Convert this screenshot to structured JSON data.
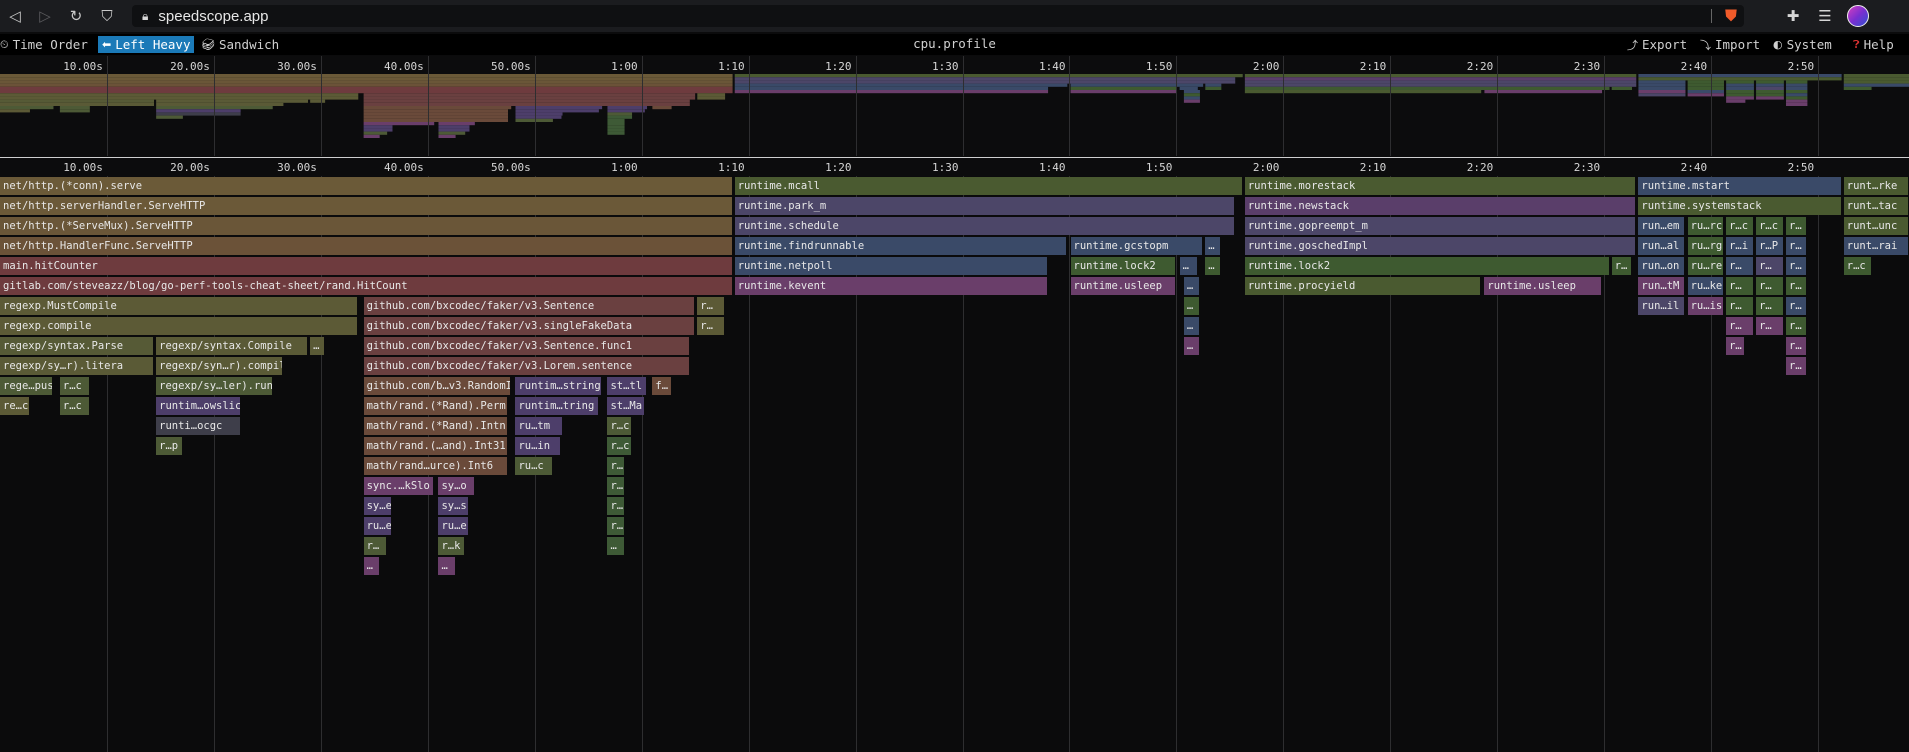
{
  "browser": {
    "url": "speedscope.app",
    "back_icon": "back-arrow-icon",
    "forward_icon": "forward-arrow-icon",
    "reload_icon": "reload-icon",
    "bookmark_icon": "bookmark-icon",
    "lock_icon": "lock-icon",
    "shield_icon": "brave-shield-icon",
    "extensions_icon": "puzzle-icon",
    "playlist_icon": "playlist-icon"
  },
  "toolbar": {
    "time_order_label": "Time Order",
    "left_heavy_label": "Left Heavy",
    "sandwich_label": "Sandwich",
    "profile_title": "cpu.profile",
    "export_label": "Export",
    "import_label": "Import",
    "system_label": "System",
    "help_label": "Help"
  },
  "colors": {
    "selected_tab": "#1b7ab8",
    "background": "#0b0b0c"
  },
  "ruler": {
    "ticks": [
      "10.00s",
      "20.00s",
      "30.00s",
      "40.00s",
      "50.00s",
      "1:00",
      "1:10",
      "1:20",
      "1:30",
      "1:40",
      "1:50",
      "2:00",
      "2:10",
      "2:20",
      "2:30",
      "2:40",
      "2:50"
    ]
  },
  "chart_data": {
    "type": "flame",
    "x_unit": "time",
    "x_ticks": [
      "10.00s",
      "20.00s",
      "30.00s",
      "40.00s",
      "50.00s",
      "1:00",
      "1:10",
      "1:20",
      "1:30",
      "1:40",
      "1:50",
      "2:00",
      "2:10",
      "2:20",
      "2:30",
      "2:40",
      "2:50"
    ],
    "frames": [
      {
        "name": "net/http.(*conn).serve",
        "depth": 0,
        "start": 0,
        "end": 68.5,
        "color": "#6b5a38"
      },
      {
        "name": "net/http.serverHandler.ServeHTTP",
        "depth": 1,
        "start": 0,
        "end": 68.5,
        "color": "#6b5938"
      },
      {
        "name": "net/http.(*ServeMux).ServeHTTP",
        "depth": 2,
        "start": 0,
        "end": 68.5,
        "color": "#6a5638"
      },
      {
        "name": "net/http.HandlerFunc.ServeHTTP",
        "depth": 3,
        "start": 0,
        "end": 68.5,
        "color": "#6b5238"
      },
      {
        "name": "main.hitCounter",
        "depth": 4,
        "start": 0,
        "end": 68.5,
        "color": "#6e3b3e"
      },
      {
        "name": "gitlab.com/steveazz/blog/go-perf-tools-cheat-sheet/rand.HitCount",
        "depth": 5,
        "start": 0,
        "end": 68.5,
        "color": "#6e3b3e"
      },
      {
        "name": "regexp.MustCompile",
        "depth": 6,
        "start": 0,
        "end": 33.5,
        "color": "#5c5a36"
      },
      {
        "name": "github.com/bxcodec/faker/v3.Sentence",
        "depth": 6,
        "start": 34,
        "end": 65,
        "color": "#6a4040"
      },
      {
        "name": "r…",
        "depth": 6,
        "start": 65.2,
        "end": 67.8,
        "color": "#5c5a36"
      },
      {
        "name": "regexp.compile",
        "depth": 7,
        "start": 0,
        "end": 33.5,
        "color": "#5c5a36"
      },
      {
        "name": "github.com/bxcodec/faker/v3.singleFakeData",
        "depth": 7,
        "start": 34,
        "end": 65,
        "color": "#6a4040"
      },
      {
        "name": "r…",
        "depth": 7,
        "start": 65.2,
        "end": 67.8,
        "color": "#5c5a36"
      },
      {
        "name": "regexp/syntax.Parse",
        "depth": 8,
        "start": 0,
        "end": 14.4,
        "color": "#565a36"
      },
      {
        "name": "regexp/syntax.Compile",
        "depth": 8,
        "start": 14.6,
        "end": 28.8,
        "color": "#5a5a36"
      },
      {
        "name": "…",
        "depth": 8,
        "start": 29,
        "end": 30.4,
        "color": "#5a5a36"
      },
      {
        "name": "github.com/bxcodec/faker/v3.Sentence.func1",
        "depth": 8,
        "start": 34,
        "end": 64.5,
        "color": "#6a4040"
      },
      {
        "name": "regexp/sy…r).litera",
        "depth": 9,
        "start": 0,
        "end": 14.4,
        "color": "#5a5a36"
      },
      {
        "name": "regexp/syn…r).compil",
        "depth": 9,
        "start": 14.6,
        "end": 26.5,
        "color": "#5a5a36"
      },
      {
        "name": "github.com/bxcodec/faker/v3.Lorem.sentence",
        "depth": 9,
        "start": 34,
        "end": 64.5,
        "color": "#6a4040"
      },
      {
        "name": "rege…pus",
        "depth": 10,
        "start": 0,
        "end": 5,
        "color": "#4d5a36"
      },
      {
        "name": "r…c",
        "depth": 10,
        "start": 5.6,
        "end": 8.4,
        "color": "#4d5a36"
      },
      {
        "name": "regexp/sy…ler).run",
        "depth": 10,
        "start": 14.6,
        "end": 25.5,
        "color": "#4d5a36"
      },
      {
        "name": "github.com/b…v3.RandomIn",
        "depth": 10,
        "start": 34,
        "end": 47.8,
        "color": "#6a4a3a"
      },
      {
        "name": "runtim…string",
        "depth": 10,
        "start": 48.2,
        "end": 56.3,
        "color": "#4d3e6a"
      },
      {
        "name": "st…tl",
        "depth": 10,
        "start": 56.8,
        "end": 60.5,
        "color": "#4d3e6a"
      },
      {
        "name": "f…",
        "depth": 10,
        "start": 61,
        "end": 62.8,
        "color": "#6a4a3a"
      },
      {
        "name": "re…ca",
        "depth": 11,
        "start": 0,
        "end": 2.8,
        "color": "#5c5a36"
      },
      {
        "name": "r…c",
        "depth": 11,
        "start": 5.6,
        "end": 8.4,
        "color": "#4d5a36"
      },
      {
        "name": "runtim…owslic",
        "depth": 11,
        "start": 14.6,
        "end": 22.5,
        "color": "#4d3e6a"
      },
      {
        "name": "math/rand.(*Rand).Perm",
        "depth": 11,
        "start": 34,
        "end": 47.5,
        "color": "#6a4a3a"
      },
      {
        "name": "runtim…tring",
        "depth": 11,
        "start": 48.2,
        "end": 56,
        "color": "#4d3e6a"
      },
      {
        "name": "st…Ma",
        "depth": 11,
        "start": 56.8,
        "end": 60.3,
        "color": "#4d3e6a"
      },
      {
        "name": "runti…ocgc",
        "depth": 12,
        "start": 14.6,
        "end": 22.5,
        "color": "#3e3e4a"
      },
      {
        "name": "math/rand.(*Rand).Intn",
        "depth": 12,
        "start": 34,
        "end": 47.5,
        "color": "#6a4a3a"
      },
      {
        "name": "ru…tm",
        "depth": 12,
        "start": 48.2,
        "end": 52.6,
        "color": "#4d3e6a"
      },
      {
        "name": "r…c",
        "depth": 12,
        "start": 56.8,
        "end": 59.1,
        "color": "#4d5a36"
      },
      {
        "name": "r…p",
        "depth": 13,
        "start": 14.6,
        "end": 17.1,
        "color": "#4d5a36"
      },
      {
        "name": "math/rand.(…and).Int31",
        "depth": 13,
        "start": 34,
        "end": 47.5,
        "color": "#6a4a3a"
      },
      {
        "name": "ru…in",
        "depth": 13,
        "start": 48.2,
        "end": 52.5,
        "color": "#4d3e6a"
      },
      {
        "name": "r…c",
        "depth": 13,
        "start": 56.8,
        "end": 59.1,
        "color": "#3e5a36"
      },
      {
        "name": "math/rand…urce).Int6",
        "depth": 14,
        "start": 34,
        "end": 47.5,
        "color": "#6a4a3a"
      },
      {
        "name": "ru…c",
        "depth": 14,
        "start": 48.2,
        "end": 51.7,
        "color": "#4d5a36"
      },
      {
        "name": "r…",
        "depth": 14,
        "start": 56.8,
        "end": 58.4,
        "color": "#3e5a36"
      },
      {
        "name": "sync.…kSlo",
        "depth": 15,
        "start": 34,
        "end": 40.6,
        "color": "#6a3e6a"
      },
      {
        "name": "sy…o",
        "depth": 15,
        "start": 41,
        "end": 44.4,
        "color": "#6a3e6a"
      },
      {
        "name": "r…",
        "depth": 15,
        "start": 56.8,
        "end": 58.4,
        "color": "#3e5a36"
      },
      {
        "name": "sy…e",
        "depth": 16,
        "start": 34,
        "end": 36.7,
        "color": "#4d3e6a"
      },
      {
        "name": "sy…s",
        "depth": 16,
        "start": 41,
        "end": 43.9,
        "color": "#4d3e6a"
      },
      {
        "name": "r…",
        "depth": 16,
        "start": 56.8,
        "end": 58.4,
        "color": "#3e5a36"
      },
      {
        "name": "ru…e",
        "depth": 17,
        "start": 34,
        "end": 36.7,
        "color": "#4d3e6a"
      },
      {
        "name": "ru…e",
        "depth": 17,
        "start": 41,
        "end": 43.9,
        "color": "#4d3e6a"
      },
      {
        "name": "r…",
        "depth": 17,
        "start": 56.8,
        "end": 58.4,
        "color": "#3e5a36"
      },
      {
        "name": "r…",
        "depth": 18,
        "start": 34,
        "end": 36.2,
        "color": "#4d5a36"
      },
      {
        "name": "r…k",
        "depth": 18,
        "start": 41,
        "end": 43.5,
        "color": "#4d5a36"
      },
      {
        "name": "…",
        "depth": 18,
        "start": 56.8,
        "end": 58.4,
        "color": "#3e5a36"
      },
      {
        "name": "…",
        "depth": 19,
        "start": 34,
        "end": 35.5,
        "color": "#6a3e6a"
      },
      {
        "name": "…",
        "depth": 19,
        "start": 41,
        "end": 42.6,
        "color": "#6a3e6a"
      },
      {
        "name": "runtime.mcall",
        "depth": 0,
        "start": 68.7,
        "end": 116.2,
        "color": "#4a5a30"
      },
      {
        "name": "runtime.park_m",
        "depth": 1,
        "start": 68.7,
        "end": 115.5,
        "color": "#4c4668"
      },
      {
        "name": "runtime.schedule",
        "depth": 2,
        "start": 68.7,
        "end": 115.5,
        "color": "#4c4668"
      },
      {
        "name": "runtime.findrunnable",
        "depth": 3,
        "start": 68.7,
        "end": 99.8,
        "color": "#3a4a68"
      },
      {
        "name": "runtime.gcstopm",
        "depth": 3,
        "start": 100.1,
        "end": 112.5,
        "color": "#3a4a68"
      },
      {
        "name": "…",
        "depth": 3,
        "start": 112.7,
        "end": 114.2,
        "color": "#3a4a68"
      },
      {
        "name": "runtime.netpoll",
        "depth": 4,
        "start": 68.7,
        "end": 98,
        "color": "#3a4a68"
      },
      {
        "name": "runtime.lock2",
        "depth": 4,
        "start": 100.1,
        "end": 110,
        "color": "#3e5a30"
      },
      {
        "name": "…",
        "depth": 4,
        "start": 110.3,
        "end": 112,
        "color": "#3a4a68"
      },
      {
        "name": "…",
        "depth": 4,
        "start": 112.7,
        "end": 114.2,
        "color": "#3e5a30"
      },
      {
        "name": "runtime.kevent",
        "depth": 5,
        "start": 68.7,
        "end": 98,
        "color": "#6a3e6a"
      },
      {
        "name": "runtime.usleep",
        "depth": 5,
        "start": 100.1,
        "end": 110,
        "color": "#6a3e6a"
      },
      {
        "name": "…",
        "depth": 5,
        "start": 110.7,
        "end": 112.2,
        "color": "#3a4a68"
      },
      {
        "name": "…",
        "depth": 6,
        "start": 110.7,
        "end": 112.2,
        "color": "#3e5a30"
      },
      {
        "name": "…",
        "depth": 7,
        "start": 110.7,
        "end": 112.2,
        "color": "#3a4a68"
      },
      {
        "name": "…",
        "depth": 8,
        "start": 110.7,
        "end": 112.2,
        "color": "#6a3e6a"
      },
      {
        "name": "runtime.morestack",
        "depth": 0,
        "start": 116.4,
        "end": 153,
        "color": "#4a5a30"
      },
      {
        "name": "runtime.newstack",
        "depth": 1,
        "start": 116.4,
        "end": 153,
        "color": "#5a3e6a"
      },
      {
        "name": "runtime.gopreempt_m",
        "depth": 2,
        "start": 116.4,
        "end": 153,
        "color": "#4c4668"
      },
      {
        "name": "runtime.goschedImpl",
        "depth": 3,
        "start": 116.4,
        "end": 153,
        "color": "#4c4668"
      },
      {
        "name": "runtime.lock2",
        "depth": 4,
        "start": 116.4,
        "end": 150.5,
        "color": "#3e5a30"
      },
      {
        "name": "r…",
        "depth": 4,
        "start": 150.7,
        "end": 152.6,
        "color": "#3e5a30"
      },
      {
        "name": "runtime.procyield",
        "depth": 5,
        "start": 116.4,
        "end": 138.5,
        "color": "#4a5a30"
      },
      {
        "name": "runtime.usleep",
        "depth": 5,
        "start": 138.8,
        "end": 149.8,
        "color": "#6a3e6a"
      },
      {
        "name": "runtime.mstart",
        "depth": 0,
        "start": 153.2,
        "end": 172.2,
        "color": "#3a4a68"
      },
      {
        "name": "runtime.systemstack",
        "depth": 1,
        "start": 153.2,
        "end": 172.2,
        "color": "#4a5a30"
      },
      {
        "name": "run…em",
        "depth": 2,
        "start": 153.2,
        "end": 157.6,
        "color": "#3a4a68"
      },
      {
        "name": "ru…rc",
        "depth": 2,
        "start": 157.8,
        "end": 161.2,
        "color": "#3e5a30"
      },
      {
        "name": "r…c",
        "depth": 2,
        "start": 161.4,
        "end": 164,
        "color": "#3e5a30"
      },
      {
        "name": "r…c",
        "depth": 2,
        "start": 164.2,
        "end": 166.8,
        "color": "#3e5a30"
      },
      {
        "name": "r…",
        "depth": 2,
        "start": 167,
        "end": 169,
        "color": "#3e5a30"
      },
      {
        "name": "run…al",
        "depth": 3,
        "start": 153.2,
        "end": 157.6,
        "color": "#3a4a68"
      },
      {
        "name": "ru…rg",
        "depth": 3,
        "start": 157.8,
        "end": 161.2,
        "color": "#3e5a30"
      },
      {
        "name": "r…i",
        "depth": 3,
        "start": 161.4,
        "end": 164,
        "color": "#3a4a68"
      },
      {
        "name": "r…P",
        "depth": 3,
        "start": 164.2,
        "end": 166.8,
        "color": "#3a4a68"
      },
      {
        "name": "r…",
        "depth": 3,
        "start": 167,
        "end": 169,
        "color": "#3a4a68"
      },
      {
        "name": "run…on",
        "depth": 4,
        "start": 153.2,
        "end": 157.6,
        "color": "#3a4a68"
      },
      {
        "name": "ru…re",
        "depth": 4,
        "start": 157.8,
        "end": 161.2,
        "color": "#3e5a30"
      },
      {
        "name": "r…",
        "depth": 4,
        "start": 161.4,
        "end": 164,
        "color": "#3a4a68"
      },
      {
        "name": "r…",
        "depth": 4,
        "start": 164.2,
        "end": 166.8,
        "color": "#4c4668"
      },
      {
        "name": "r…",
        "depth": 4,
        "start": 167,
        "end": 169,
        "color": "#3a4a68"
      },
      {
        "name": "run…tM",
        "depth": 5,
        "start": 153.2,
        "end": 157.6,
        "color": "#6a3e6a"
      },
      {
        "name": "ru…ke",
        "depth": 5,
        "start": 157.8,
        "end": 161.2,
        "color": "#3a4a68"
      },
      {
        "name": "r…",
        "depth": 5,
        "start": 161.4,
        "end": 164,
        "color": "#3e5a30"
      },
      {
        "name": "r…",
        "depth": 5,
        "start": 164.2,
        "end": 166.8,
        "color": "#3e5a30"
      },
      {
        "name": "r…",
        "depth": 5,
        "start": 167,
        "end": 169,
        "color": "#3e5a30"
      },
      {
        "name": "run…il",
        "depth": 6,
        "start": 153.2,
        "end": 157.6,
        "color": "#4c4668"
      },
      {
        "name": "ru…is",
        "depth": 6,
        "start": 157.8,
        "end": 161.2,
        "color": "#6a3e6a"
      },
      {
        "name": "r…",
        "depth": 6,
        "start": 161.4,
        "end": 164,
        "color": "#3e5a30"
      },
      {
        "name": "r…",
        "depth": 6,
        "start": 164.2,
        "end": 166.8,
        "color": "#3e5a30"
      },
      {
        "name": "r…",
        "depth": 6,
        "start": 167,
        "end": 169,
        "color": "#3a4a68"
      },
      {
        "name": "r…",
        "depth": 7,
        "start": 161.4,
        "end": 164,
        "color": "#6a3e6a"
      },
      {
        "name": "r…",
        "depth": 7,
        "start": 164.2,
        "end": 166.8,
        "color": "#6a3e6a"
      },
      {
        "name": "r…",
        "depth": 7,
        "start": 167,
        "end": 169,
        "color": "#3e5a30"
      },
      {
        "name": "r…",
        "depth": 8,
        "start": 161.4,
        "end": 163.2,
        "color": "#6a3e6a"
      },
      {
        "name": "r…",
        "depth": 8,
        "start": 167,
        "end": 169,
        "color": "#6a3e6a"
      },
      {
        "name": "r…",
        "depth": 9,
        "start": 167,
        "end": 169,
        "color": "#6a3e6a"
      },
      {
        "name": "runt…rke",
        "depth": 0,
        "start": 172.4,
        "end": 178.5,
        "color": "#4a5a30"
      },
      {
        "name": "runt…tac",
        "depth": 1,
        "start": 172.4,
        "end": 178.5,
        "color": "#4a5a30"
      },
      {
        "name": "runt…unc",
        "depth": 2,
        "start": 172.4,
        "end": 178.5,
        "color": "#4a5a30"
      },
      {
        "name": "runt…rai",
        "depth": 3,
        "start": 172.4,
        "end": 178.5,
        "color": "#3a4a68"
      },
      {
        "name": "r…c",
        "depth": 4,
        "start": 172.4,
        "end": 175,
        "color": "#3e5a30"
      }
    ]
  }
}
